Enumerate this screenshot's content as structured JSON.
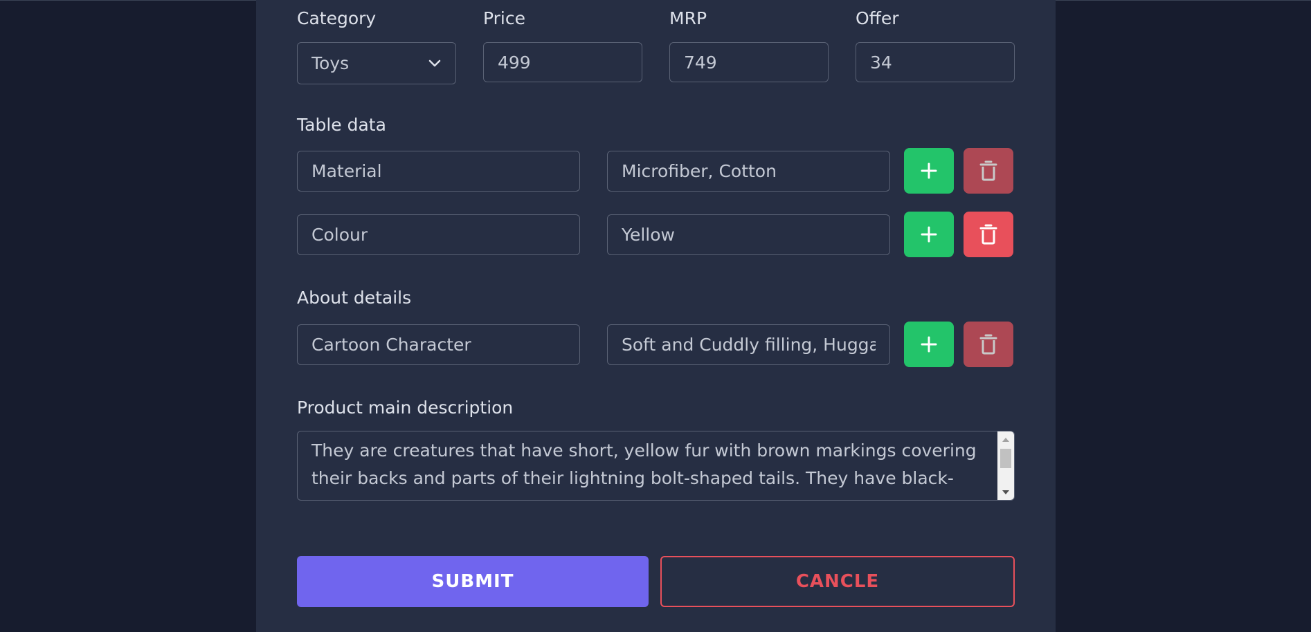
{
  "pricing": {
    "category": {
      "label": "Category",
      "value": "Toys"
    },
    "price": {
      "label": "Price",
      "value": "499"
    },
    "mrp": {
      "label": "MRP",
      "value": "749"
    },
    "offer": {
      "label": "Offer",
      "value": "34"
    }
  },
  "table_data": {
    "label": "Table data",
    "rows": [
      {
        "key": "Material",
        "value": "Microfiber, Cotton"
      },
      {
        "key": "Colour",
        "value": "Yellow"
      }
    ]
  },
  "about_details": {
    "label": "About details",
    "rows": [
      {
        "key": "Cartoon Character",
        "value": "Soft and Cuddly filling, Huggab"
      }
    ]
  },
  "description": {
    "label": "Product main description",
    "value": "They are creatures that have short, yellow fur with brown markings covering their backs and parts of their lightning bolt-shaped tails. They have black-"
  },
  "actions": {
    "submit_label": "SUBMIT",
    "cancel_label": "CANCLE"
  },
  "icons": {
    "add": "plus-icon",
    "delete": "trash-icon",
    "dropdown": "chevron-down-icon"
  },
  "colors": {
    "add_button": "#23c46a",
    "delete_button": "#e8505b",
    "submit_button": "#7065ee",
    "cancel_border": "#e8505b"
  }
}
